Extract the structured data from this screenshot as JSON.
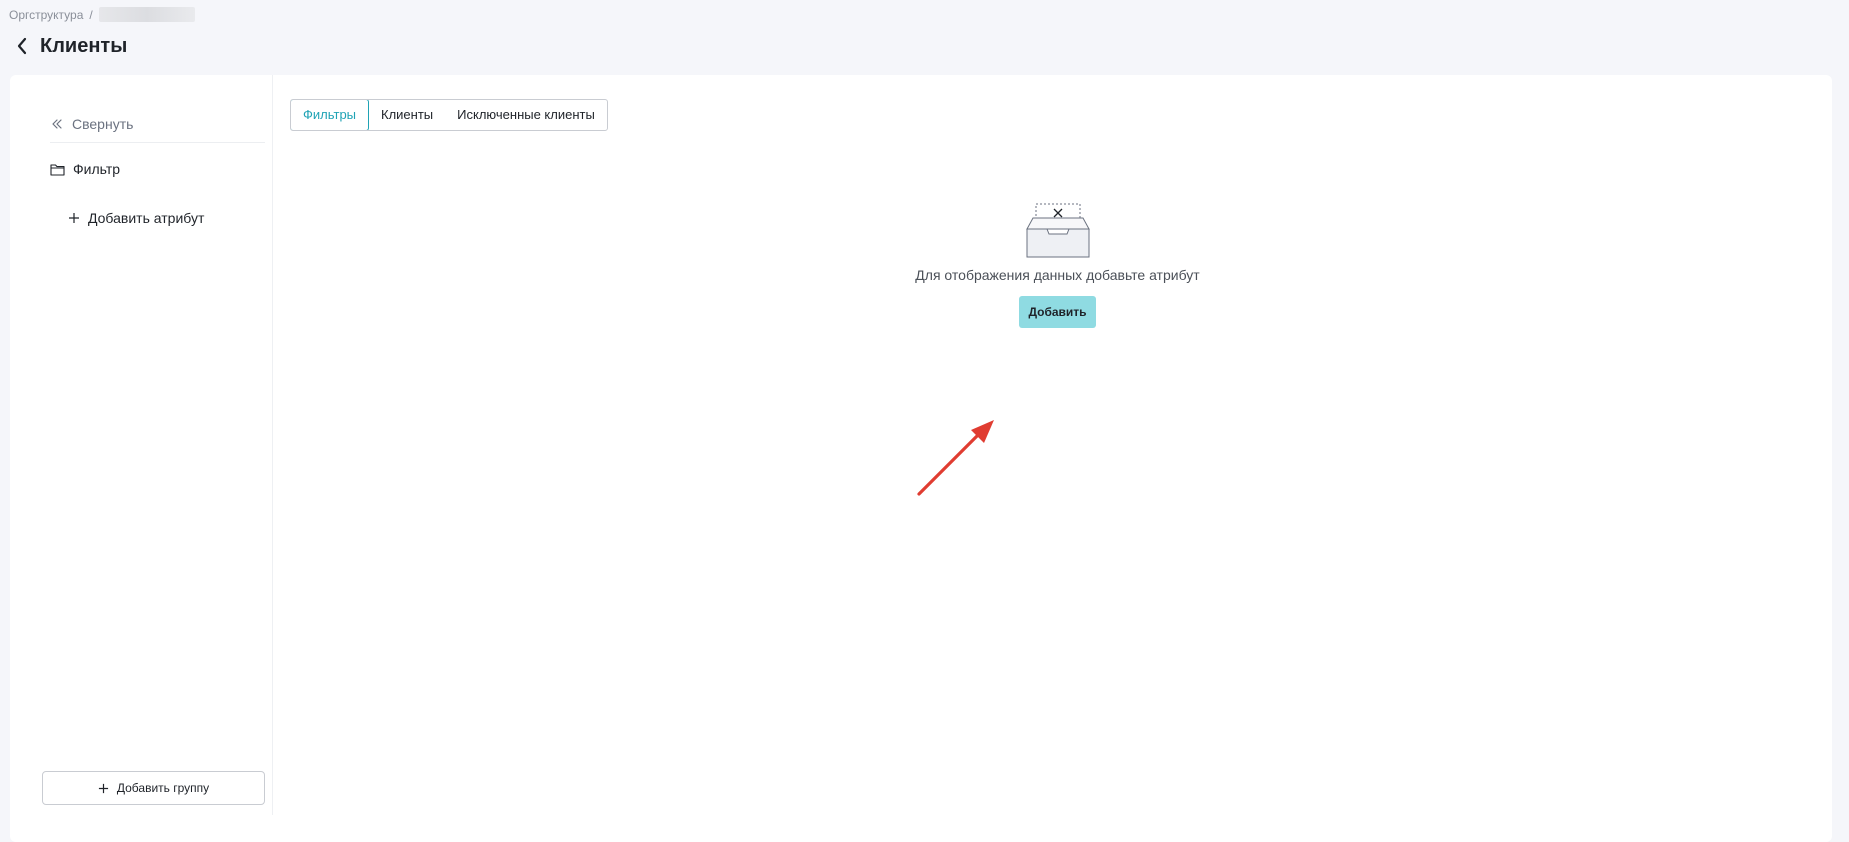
{
  "breadcrumb": {
    "root": "Оргструктура",
    "separator": "/"
  },
  "header": {
    "title": "Клиенты"
  },
  "sidebar": {
    "collapse_label": "Свернуть",
    "filter_label": "Фильтр",
    "add_attribute_label": "Добавить атрибут",
    "add_group_label": "Добавить группу"
  },
  "tabs": [
    {
      "label": "Фильтры",
      "active": true
    },
    {
      "label": "Клиенты",
      "active": false
    },
    {
      "label": "Исключенные клиенты",
      "active": false
    }
  ],
  "empty_state": {
    "message": "Для отображения данных добавьте атрибут",
    "button_label": "Добавить"
  },
  "colors": {
    "accent": "#1fa3b5",
    "button_bg": "#8fdbe2",
    "annotation_arrow": "#e03c31",
    "page_bg": "#f5f6fa"
  },
  "icons": [
    "chevron-left-icon",
    "double-chevron-left-icon",
    "folder-icon",
    "plus-icon",
    "empty-box-icon",
    "red-arrow-annotation"
  ]
}
